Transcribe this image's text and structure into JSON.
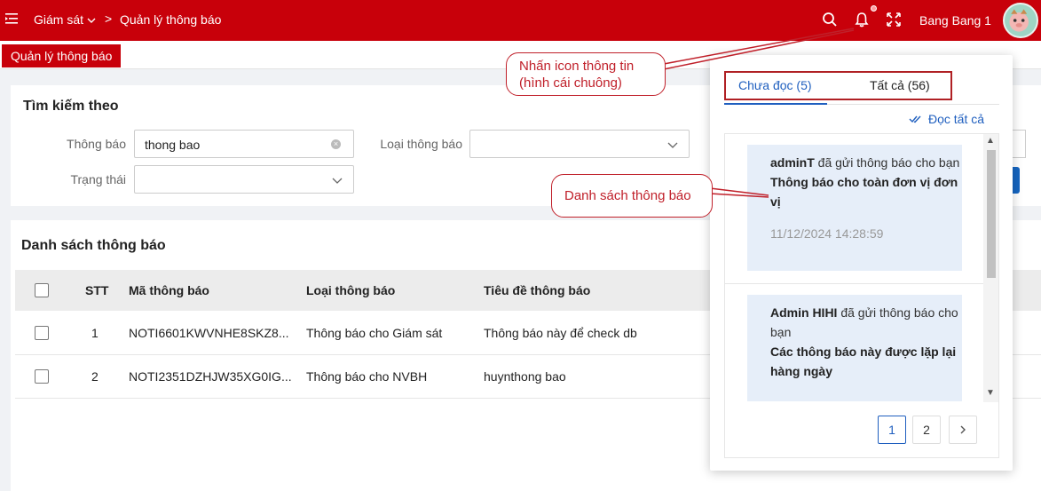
{
  "topbar": {
    "crumb_root": "Giám sát",
    "crumb_current": "Quản lý thông báo",
    "username": "Bang Bang 1"
  },
  "tabs": {
    "active": "Quản lý thông báo"
  },
  "search": {
    "title": "Tìm kiếm theo",
    "notification_label": "Thông báo",
    "notification_value": "thong bao",
    "type_label": "Loại thông báo",
    "type_value": "",
    "status_label": "Trạng thái",
    "status_value": ""
  },
  "list": {
    "title": "Danh sách thông báo",
    "columns": [
      "STT",
      "Mã thông báo",
      "Loại thông báo",
      "Tiêu đề thông báo"
    ],
    "rows": [
      {
        "stt": "1",
        "code": "NOTI6601KWVNHE8SKZ8...",
        "type": "Thông báo cho Giám sát",
        "subject": "Thông báo này để check db"
      },
      {
        "stt": "2",
        "code": "NOTI2351DZHJW35XG0IG...",
        "type": "Thông báo cho NVBH",
        "subject": "huynthong bao"
      }
    ]
  },
  "notifications": {
    "tab_unread": "Chưa đọc (5)",
    "tab_all": "Tất cả (56)",
    "read_all": "Đọc tất cả",
    "items": [
      {
        "sender": "adminT",
        "action": "đã gửi thông báo cho bạn",
        "title": "Thông báo cho toàn đơn vị đơn vị",
        "time": "11/12/2024 14:28:59"
      },
      {
        "sender": "Admin HIHI",
        "action": "đã gửi thông báo cho bạn",
        "title": "Các thông báo này được lặp lại hàng ngày"
      }
    ],
    "pages": [
      "1",
      "2"
    ],
    "current_page": "1"
  },
  "callouts": {
    "bell_hint": "Nhấn icon thông tin (hình cái chuông)",
    "list_hint": "Danh sách thông báo"
  },
  "colors": {
    "brand_red": "#c8000a",
    "link_blue": "#1f5fbf",
    "annotation_red": "#c0202a",
    "notif_bg": "#e6eef9"
  },
  "icons": [
    "menu-icon",
    "chevron-down-icon",
    "search-icon",
    "bell-icon",
    "fullscreen-icon",
    "avatar",
    "clear-icon",
    "double-check-icon",
    "chevron-right-icon"
  ]
}
